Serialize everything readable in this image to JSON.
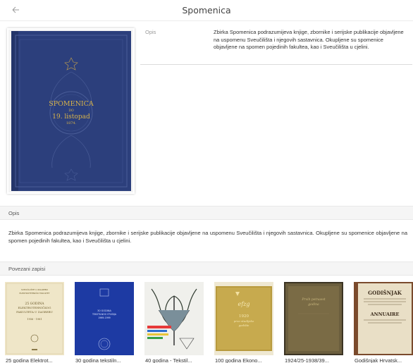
{
  "header": {
    "title": "Spomenica",
    "back_icon": "back-arrow-icon"
  },
  "cover": {
    "line1": "SPOMENICA",
    "line2": "DO",
    "line3": "19. listopad",
    "line4": "1874.",
    "binding_color": "#2c3f7c",
    "lettering_color": "#d8b34a"
  },
  "info": {
    "key": "Opis",
    "value": "Zbirka Spomenica podrazumijeva knjige, zbornike i serijske publikacije objavljene na uspomenu Sveučilišta i njegovih sastavnica. Okupljene su spomenice objavljene na spomen pojedinih fakultea, kao i Sveučilišta u cjelini."
  },
  "description_section": {
    "heading": "Opis",
    "text": "Zbirka Spomenica podrazumijeva knjige, zbornike i serijske publikacije objavljene na uspomenu Sveučilišta i njegovih sastavnica. Okupljene su spomenice objavljene na spomen pojedinih fakultea, kao i Sveučilišta u cjelini."
  },
  "related": {
    "heading": "Povezani zapisi",
    "items": [
      {
        "caption": "25 godina Elektrot...",
        "cover_lines": [
          "SVEUČILIŠTE U ZAGREBU",
          "ELEKTROTEHNIČKI FAKULTET",
          "25 GODINA",
          "ELEKTROTEHNIČKOG",
          "FAKULTETA U ZAGREBU",
          "1956 - 1981"
        ]
      },
      {
        "caption": "30 godina tekstiln...",
        "cover_lines": [
          "30 GODINA",
          "TEKSTILNOG STUDIJA",
          "1969-1999"
        ]
      },
      {
        "caption": "40 godina - Tekstil..."
      },
      {
        "caption": "100 godina Ekono...",
        "cover_lines": [
          "efzg",
          "1920",
          "prvo studijsko",
          "godište"
        ]
      },
      {
        "caption": "1924/25-1938/39...",
        "cover_lines": [
          "Prvih petnaest",
          "godina"
        ]
      },
      {
        "caption": "Godišnjak Hrvatsk...",
        "cover_lines": [
          "GODIŠNJAK",
          "ANNUAIRE"
        ]
      }
    ]
  }
}
